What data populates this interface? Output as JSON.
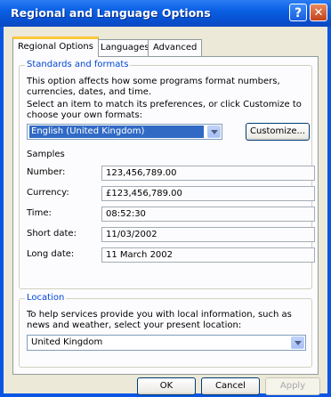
{
  "window": {
    "title": "Regional and Language Options",
    "help_glyph": "?",
    "close_glyph": "✕"
  },
  "tabs": [
    {
      "label": "Regional Options",
      "active": true
    },
    {
      "label": "Languages",
      "active": false
    },
    {
      "label": "Advanced",
      "active": false
    }
  ],
  "standards": {
    "legend": "Standards and formats",
    "description": "This option affects how some programs format numbers, currencies, dates, and time.",
    "select_prompt": "Select an item to match its preferences, or click Customize to choose your own formats:",
    "format_value": "English (United Kingdom)",
    "customize_label": "Customize..."
  },
  "samples": {
    "heading": "Samples",
    "rows": [
      {
        "label": "Number:",
        "value": "123,456,789.00"
      },
      {
        "label": "Currency:",
        "value": "£123,456,789.00"
      },
      {
        "label": "Time:",
        "value": "08:52:30"
      },
      {
        "label": "Short date:",
        "value": "11/03/2002"
      },
      {
        "label": "Long date:",
        "value": "11 March 2002"
      }
    ]
  },
  "location": {
    "legend": "Location",
    "description": "To help services provide you with local information, such as news and weather, select your present location:",
    "value": "United Kingdom"
  },
  "footer": {
    "ok_label": "OK",
    "cancel_label": "Cancel",
    "apply_label": "Apply"
  },
  "colors": {
    "titlebar": "#0a5fe3",
    "dialog": "#ece9d8",
    "selection": "#316ac5",
    "group_legend": "#0046d5"
  }
}
